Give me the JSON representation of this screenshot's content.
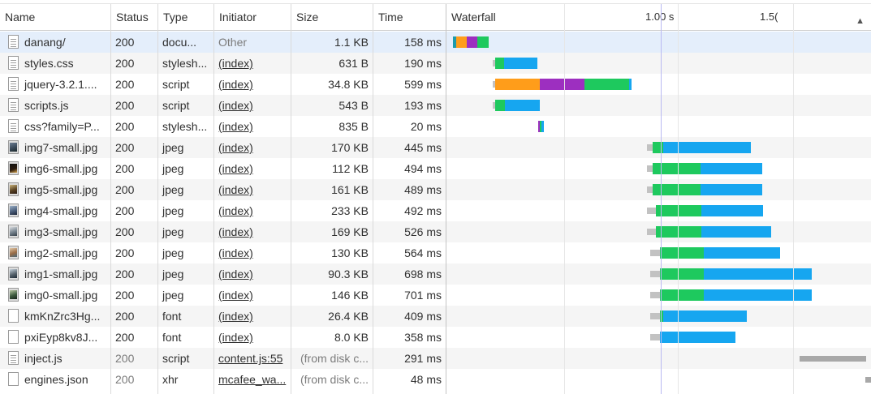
{
  "headers": {
    "name": "Name",
    "status": "Status",
    "type": "Type",
    "initiator": "Initiator",
    "size": "Size",
    "time": "Time",
    "waterfall": "Waterfall",
    "tick_1": "1.00 s",
    "tick_2": "1.5("
  },
  "colors": {
    "queue": "#c2c2c2",
    "dns": "#1e9bab",
    "connect": "#ff9d1a",
    "ssl": "#9d2fc0",
    "waiting": "#1ec95e",
    "download": "#16a6f0",
    "gray_bar": "#a8a8a8",
    "marker_line": "#9c9cf0",
    "grid_line": "#e1e1e1",
    "selected_row": "#e4eefb"
  },
  "rows": [
    {
      "name": "danang/",
      "status": "200",
      "type": "docu...",
      "initiator": "Other",
      "size": "1.1 KB",
      "time": "158 ms",
      "icon": "document-icon",
      "selected": true,
      "initiator_link": false,
      "status_muted": false,
      "size_muted": false,
      "timing": [
        {
          "phase": "dns",
          "start": 558,
          "end": 562
        },
        {
          "phase": "connect",
          "start": 562,
          "end": 575
        },
        {
          "phase": "ssl",
          "start": 575,
          "end": 588
        },
        {
          "phase": "waiting",
          "start": 588,
          "end": 602
        }
      ]
    },
    {
      "name": "styles.css",
      "status": "200",
      "type": "stylesh...",
      "initiator": "(index)",
      "size": "631 B",
      "time": "190 ms",
      "icon": "document-icon",
      "selected": false,
      "initiator_link": true,
      "status_muted": false,
      "size_muted": false,
      "timing": [
        {
          "phase": "queue",
          "start": 607,
          "end": 610
        },
        {
          "phase": "waiting",
          "start": 610,
          "end": 621
        },
        {
          "phase": "download",
          "start": 621,
          "end": 662
        }
      ]
    },
    {
      "name": "jquery-3.2.1....",
      "status": "200",
      "type": "script",
      "initiator": "(index)",
      "size": "34.8 KB",
      "time": "599 ms",
      "icon": "document-icon",
      "selected": false,
      "initiator_link": true,
      "status_muted": false,
      "size_muted": false,
      "timing": [
        {
          "phase": "queue",
          "start": 607,
          "end": 610
        },
        {
          "phase": "connect",
          "start": 610,
          "end": 665
        },
        {
          "phase": "ssl",
          "start": 665,
          "end": 720
        },
        {
          "phase": "waiting",
          "start": 720,
          "end": 775
        },
        {
          "phase": "download",
          "start": 775,
          "end": 778
        }
      ]
    },
    {
      "name": "scripts.js",
      "status": "200",
      "type": "script",
      "initiator": "(index)",
      "size": "543 B",
      "time": "193 ms",
      "icon": "document-icon",
      "selected": false,
      "initiator_link": true,
      "status_muted": false,
      "size_muted": false,
      "timing": [
        {
          "phase": "queue",
          "start": 607,
          "end": 610
        },
        {
          "phase": "waiting",
          "start": 610,
          "end": 622
        },
        {
          "phase": "download",
          "start": 622,
          "end": 665
        }
      ]
    },
    {
      "name": "css?family=P...",
      "status": "200",
      "type": "stylesh...",
      "initiator": "(index)",
      "size": "835 B",
      "time": "20 ms",
      "icon": "document-icon",
      "selected": false,
      "initiator_link": true,
      "status_muted": false,
      "size_muted": false,
      "timing": [
        {
          "phase": "ssl",
          "start": 663,
          "end": 665
        },
        {
          "phase": "waiting",
          "start": 665,
          "end": 667
        },
        {
          "phase": "download",
          "start": 667,
          "end": 670
        }
      ]
    },
    {
      "name": "img7-small.jpg",
      "status": "200",
      "type": "jpeg",
      "initiator": "(index)",
      "size": "170 KB",
      "time": "445 ms",
      "icon": "image-thumbnail-icon",
      "thumb": "v7",
      "selected": false,
      "initiator_link": true,
      "status_muted": false,
      "size_muted": false,
      "timing": [
        {
          "phase": "queue",
          "start": 797,
          "end": 804
        },
        {
          "phase": "waiting",
          "start": 804,
          "end": 817
        },
        {
          "phase": "download",
          "start": 817,
          "end": 925
        }
      ]
    },
    {
      "name": "img6-small.jpg",
      "status": "200",
      "type": "jpeg",
      "initiator": "(index)",
      "size": "112 KB",
      "time": "494 ms",
      "icon": "image-thumbnail-icon",
      "thumb": "v6",
      "selected": false,
      "initiator_link": true,
      "status_muted": false,
      "size_muted": false,
      "timing": [
        {
          "phase": "queue",
          "start": 797,
          "end": 804
        },
        {
          "phase": "waiting",
          "start": 804,
          "end": 863
        },
        {
          "phase": "download",
          "start": 863,
          "end": 939
        }
      ]
    },
    {
      "name": "img5-small.jpg",
      "status": "200",
      "type": "jpeg",
      "initiator": "(index)",
      "size": "161 KB",
      "time": "489 ms",
      "icon": "image-thumbnail-icon",
      "thumb": "v5",
      "selected": false,
      "initiator_link": true,
      "status_muted": false,
      "size_muted": false,
      "timing": [
        {
          "phase": "queue",
          "start": 797,
          "end": 804
        },
        {
          "phase": "waiting",
          "start": 804,
          "end": 863
        },
        {
          "phase": "download",
          "start": 863,
          "end": 939
        }
      ]
    },
    {
      "name": "img4-small.jpg",
      "status": "200",
      "type": "jpeg",
      "initiator": "(index)",
      "size": "233 KB",
      "time": "492 ms",
      "icon": "image-thumbnail-icon",
      "thumb": "v4",
      "selected": false,
      "initiator_link": true,
      "status_muted": false,
      "size_muted": false,
      "timing": [
        {
          "phase": "queue",
          "start": 797,
          "end": 808
        },
        {
          "phase": "waiting",
          "start": 808,
          "end": 864
        },
        {
          "phase": "download",
          "start": 864,
          "end": 940
        }
      ]
    },
    {
      "name": "img3-small.jpg",
      "status": "200",
      "type": "jpeg",
      "initiator": "(index)",
      "size": "169 KB",
      "time": "526 ms",
      "icon": "image-thumbnail-icon",
      "thumb": "v3",
      "selected": false,
      "initiator_link": true,
      "status_muted": false,
      "size_muted": false,
      "timing": [
        {
          "phase": "queue",
          "start": 797,
          "end": 808
        },
        {
          "phase": "waiting",
          "start": 808,
          "end": 864
        },
        {
          "phase": "download",
          "start": 864,
          "end": 950
        }
      ]
    },
    {
      "name": "img2-small.jpg",
      "status": "200",
      "type": "jpeg",
      "initiator": "(index)",
      "size": "130 KB",
      "time": "564 ms",
      "icon": "image-thumbnail-icon",
      "thumb": "v2",
      "selected": false,
      "initiator_link": true,
      "status_muted": false,
      "size_muted": false,
      "timing": [
        {
          "phase": "queue",
          "start": 801,
          "end": 813
        },
        {
          "phase": "waiting",
          "start": 813,
          "end": 867
        },
        {
          "phase": "download",
          "start": 867,
          "end": 961
        }
      ]
    },
    {
      "name": "img1-small.jpg",
      "status": "200",
      "type": "jpeg",
      "initiator": "(index)",
      "size": "90.3 KB",
      "time": "698 ms",
      "icon": "image-thumbnail-icon",
      "thumb": "v1",
      "selected": false,
      "initiator_link": true,
      "status_muted": false,
      "size_muted": false,
      "timing": [
        {
          "phase": "queue",
          "start": 801,
          "end": 813
        },
        {
          "phase": "waiting",
          "start": 813,
          "end": 867
        },
        {
          "phase": "download",
          "start": 867,
          "end": 1000
        }
      ]
    },
    {
      "name": "img0-small.jpg",
      "status": "200",
      "type": "jpeg",
      "initiator": "(index)",
      "size": "146 KB",
      "time": "701 ms",
      "icon": "image-thumbnail-icon",
      "thumb": "v0",
      "selected": false,
      "initiator_link": true,
      "status_muted": false,
      "size_muted": false,
      "timing": [
        {
          "phase": "queue",
          "start": 801,
          "end": 813
        },
        {
          "phase": "waiting",
          "start": 813,
          "end": 867
        },
        {
          "phase": "download",
          "start": 867,
          "end": 1000
        }
      ]
    },
    {
      "name": "kmKnZrc3Hg...",
      "status": "200",
      "type": "font",
      "initiator": "(index)",
      "size": "26.4 KB",
      "time": "409 ms",
      "icon": "blank-file-icon",
      "selected": false,
      "initiator_link": true,
      "status_muted": false,
      "size_muted": false,
      "timing": [
        {
          "phase": "queue",
          "start": 801,
          "end": 813
        },
        {
          "phase": "waiting",
          "start": 813,
          "end": 817
        },
        {
          "phase": "download",
          "start": 817,
          "end": 920
        }
      ]
    },
    {
      "name": "pxiEyp8kv8J...",
      "status": "200",
      "type": "font",
      "initiator": "(index)",
      "size": "8.0 KB",
      "time": "358 ms",
      "icon": "blank-file-icon",
      "selected": false,
      "initiator_link": true,
      "status_muted": false,
      "size_muted": false,
      "timing": [
        {
          "phase": "queue",
          "start": 801,
          "end": 813
        },
        {
          "phase": "download",
          "start": 813,
          "end": 906
        }
      ]
    },
    {
      "name": "inject.js",
      "status": "200",
      "type": "script",
      "initiator": "content.js:55",
      "size": "(from disk c...",
      "time": "291 ms",
      "icon": "document-icon",
      "selected": false,
      "initiator_link": true,
      "status_muted": true,
      "size_muted": true,
      "timing": [
        {
          "phase": "gray_bar",
          "start": 985,
          "end": 1067
        }
      ]
    },
    {
      "name": "engines.json",
      "status": "200",
      "type": "xhr",
      "initiator": "mcafee_wa...",
      "size": "(from disk c...",
      "time": "48 ms",
      "icon": "blank-file-icon",
      "selected": false,
      "initiator_link": true,
      "status_muted": true,
      "size_muted": true,
      "timing": [
        {
          "phase": "gray_bar",
          "start": 1066,
          "end": 1073
        }
      ]
    }
  ]
}
